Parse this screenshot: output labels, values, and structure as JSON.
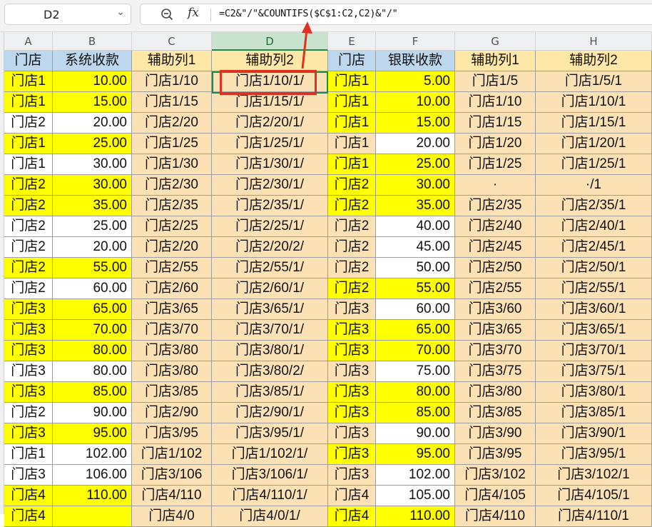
{
  "formula_bar": {
    "name_box": "D2",
    "chevron_icon": "chevron-down-icon",
    "zoom_icon": "zoom-icon",
    "fx_label": "fx",
    "formula": "=C2&\"/\"&COUNTIFS($C$1:C2,C2)&\"/\""
  },
  "columns": [
    "A",
    "B",
    "C",
    "D",
    "E",
    "F",
    "G",
    "H"
  ],
  "selected_column": "D",
  "header_row": [
    "门店",
    "系统收款",
    "辅助列1",
    "辅助列2",
    "门店",
    "银联收款",
    "辅助列1",
    "辅助列2"
  ],
  "rows": [
    {
      "a": "门店1",
      "b": "10.00",
      "c": "门店1/10",
      "d": "门店1/10/1/",
      "e": "门店1",
      "f": "5.00",
      "g": "门店1/5",
      "h": "门店1/5/1",
      "ya": true,
      "ye": true
    },
    {
      "a": "门店1",
      "b": "15.00",
      "c": "门店1/15",
      "d": "门店1/15/1/",
      "e": "门店1",
      "f": "10.00",
      "g": "门店1/10",
      "h": "门店1/10/1",
      "ya": true,
      "ye": true
    },
    {
      "a": "门店2",
      "b": "20.00",
      "c": "门店2/20",
      "d": "门店2/20/1/",
      "e": "门店1",
      "f": "15.00",
      "g": "门店1/15",
      "h": "门店1/15/1",
      "ya": false,
      "ye": true
    },
    {
      "a": "门店1",
      "b": "25.00",
      "c": "门店1/25",
      "d": "门店1/25/1/",
      "e": "门店1",
      "f": "20.00",
      "g": "门店1/20",
      "h": "门店1/20/1",
      "ya": true,
      "ye": false
    },
    {
      "a": "门店1",
      "b": "30.00",
      "c": "门店1/30",
      "d": "门店1/30/1/",
      "e": "门店1",
      "f": "25.00",
      "g": "门店1/25",
      "h": "门店1/25/1",
      "ya": false,
      "ye": true
    },
    {
      "a": "门店2",
      "b": "30.00",
      "c": "门店2/30",
      "d": "门店2/30/1/",
      "e": "门店2",
      "f": "30.00",
      "g": "·",
      "h": "·/1",
      "ya": true,
      "ye": true
    },
    {
      "a": "门店2",
      "b": "35.00",
      "c": "门店2/35",
      "d": "门店2/35/1/",
      "e": "门店2",
      "f": "35.00",
      "g": "门店2/35",
      "h": "门店2/35/1",
      "ya": true,
      "ye": true
    },
    {
      "a": "门店2",
      "b": "25.00",
      "c": "门店2/25",
      "d": "门店2/25/1/",
      "e": "门店2",
      "f": "40.00",
      "g": "门店2/40",
      "h": "门店2/40/1",
      "ya": false,
      "ye": false
    },
    {
      "a": "门店2",
      "b": "20.00",
      "c": "门店2/20",
      "d": "门店2/20/2/",
      "e": "门店2",
      "f": "45.00",
      "g": "门店2/45",
      "h": "门店2/45/1",
      "ya": false,
      "ye": false
    },
    {
      "a": "门店2",
      "b": "55.00",
      "c": "门店2/55",
      "d": "门店2/55/1/",
      "e": "门店2",
      "f": "50.00",
      "g": "门店2/50",
      "h": "门店2/50/1",
      "ya": true,
      "ye": false
    },
    {
      "a": "门店2",
      "b": "60.00",
      "c": "门店2/60",
      "d": "门店2/60/1/",
      "e": "门店2",
      "f": "55.00",
      "g": "门店2/55",
      "h": "门店2/55/1",
      "ya": false,
      "ye": true
    },
    {
      "a": "门店3",
      "b": "65.00",
      "c": "门店3/65",
      "d": "门店3/65/1/",
      "e": "门店3",
      "f": "60.00",
      "g": "门店3/60",
      "h": "门店3/60/1",
      "ya": true,
      "ye": false
    },
    {
      "a": "门店3",
      "b": "70.00",
      "c": "门店3/70",
      "d": "门店3/70/1/",
      "e": "门店3",
      "f": "65.00",
      "g": "门店3/65",
      "h": "门店3/65/1",
      "ya": true,
      "ye": true
    },
    {
      "a": "门店3",
      "b": "80.00",
      "c": "门店3/80",
      "d": "门店3/80/1/",
      "e": "门店3",
      "f": "70.00",
      "g": "门店3/70",
      "h": "门店3/70/1",
      "ya": true,
      "ye": true
    },
    {
      "a": "门店3",
      "b": "80.00",
      "c": "门店3/80",
      "d": "门店3/80/2/",
      "e": "门店3",
      "f": "75.00",
      "g": "门店3/75",
      "h": "门店3/75/1",
      "ya": false,
      "ye": false
    },
    {
      "a": "门店3",
      "b": "85.00",
      "c": "门店3/85",
      "d": "门店3/85/1/",
      "e": "门店3",
      "f": "80.00",
      "g": "门店3/80",
      "h": "门店3/80/1",
      "ya": true,
      "ye": true
    },
    {
      "a": "门店2",
      "b": "90.00",
      "c": "门店2/90",
      "d": "门店2/90/1/",
      "e": "门店3",
      "f": "85.00",
      "g": "门店3/85",
      "h": "门店3/85/1",
      "ya": false,
      "ye": true
    },
    {
      "a": "门店3",
      "b": "95.00",
      "c": "门店3/95",
      "d": "门店3/95/1/",
      "e": "门店3",
      "f": "90.00",
      "g": "门店3/90",
      "h": "门店3/90/1",
      "ya": true,
      "ye": false
    },
    {
      "a": "门店1",
      "b": "102.00",
      "c": "门店1/102",
      "d": "门店1/102/1/",
      "e": "门店3",
      "f": "95.00",
      "g": "门店3/95",
      "h": "门店3/95/1",
      "ya": false,
      "ye": true
    },
    {
      "a": "门店3",
      "b": "106.00",
      "c": "门店3/106",
      "d": "门店3/106/1/",
      "e": "门店3",
      "f": "102.00",
      "g": "门店3/102",
      "h": "门店3/102/1",
      "ya": false,
      "ye": false
    },
    {
      "a": "门店4",
      "b": "110.00",
      "c": "门店4/110",
      "d": "门店4/110/1/",
      "e": "门店4",
      "f": "105.00",
      "g": "门店4/105",
      "h": "门店4/105/1",
      "ya": true,
      "ye": false
    },
    {
      "a": "门店4",
      "b": "",
      "c": "门店4/0",
      "d": "门店4/0/1/",
      "e": "门店4",
      "f": "110.00",
      "g": "门店4/110",
      "h": "门店4/110/1",
      "ya": true,
      "ye": true
    }
  ],
  "colors": {
    "yellow": "#ffff00",
    "peach": "#fbe1b4",
    "header_yellow": "#ffe7a8",
    "header_blue": "#bdd7ee",
    "selection": "#1e8a45",
    "callout": "#e0301e"
  }
}
